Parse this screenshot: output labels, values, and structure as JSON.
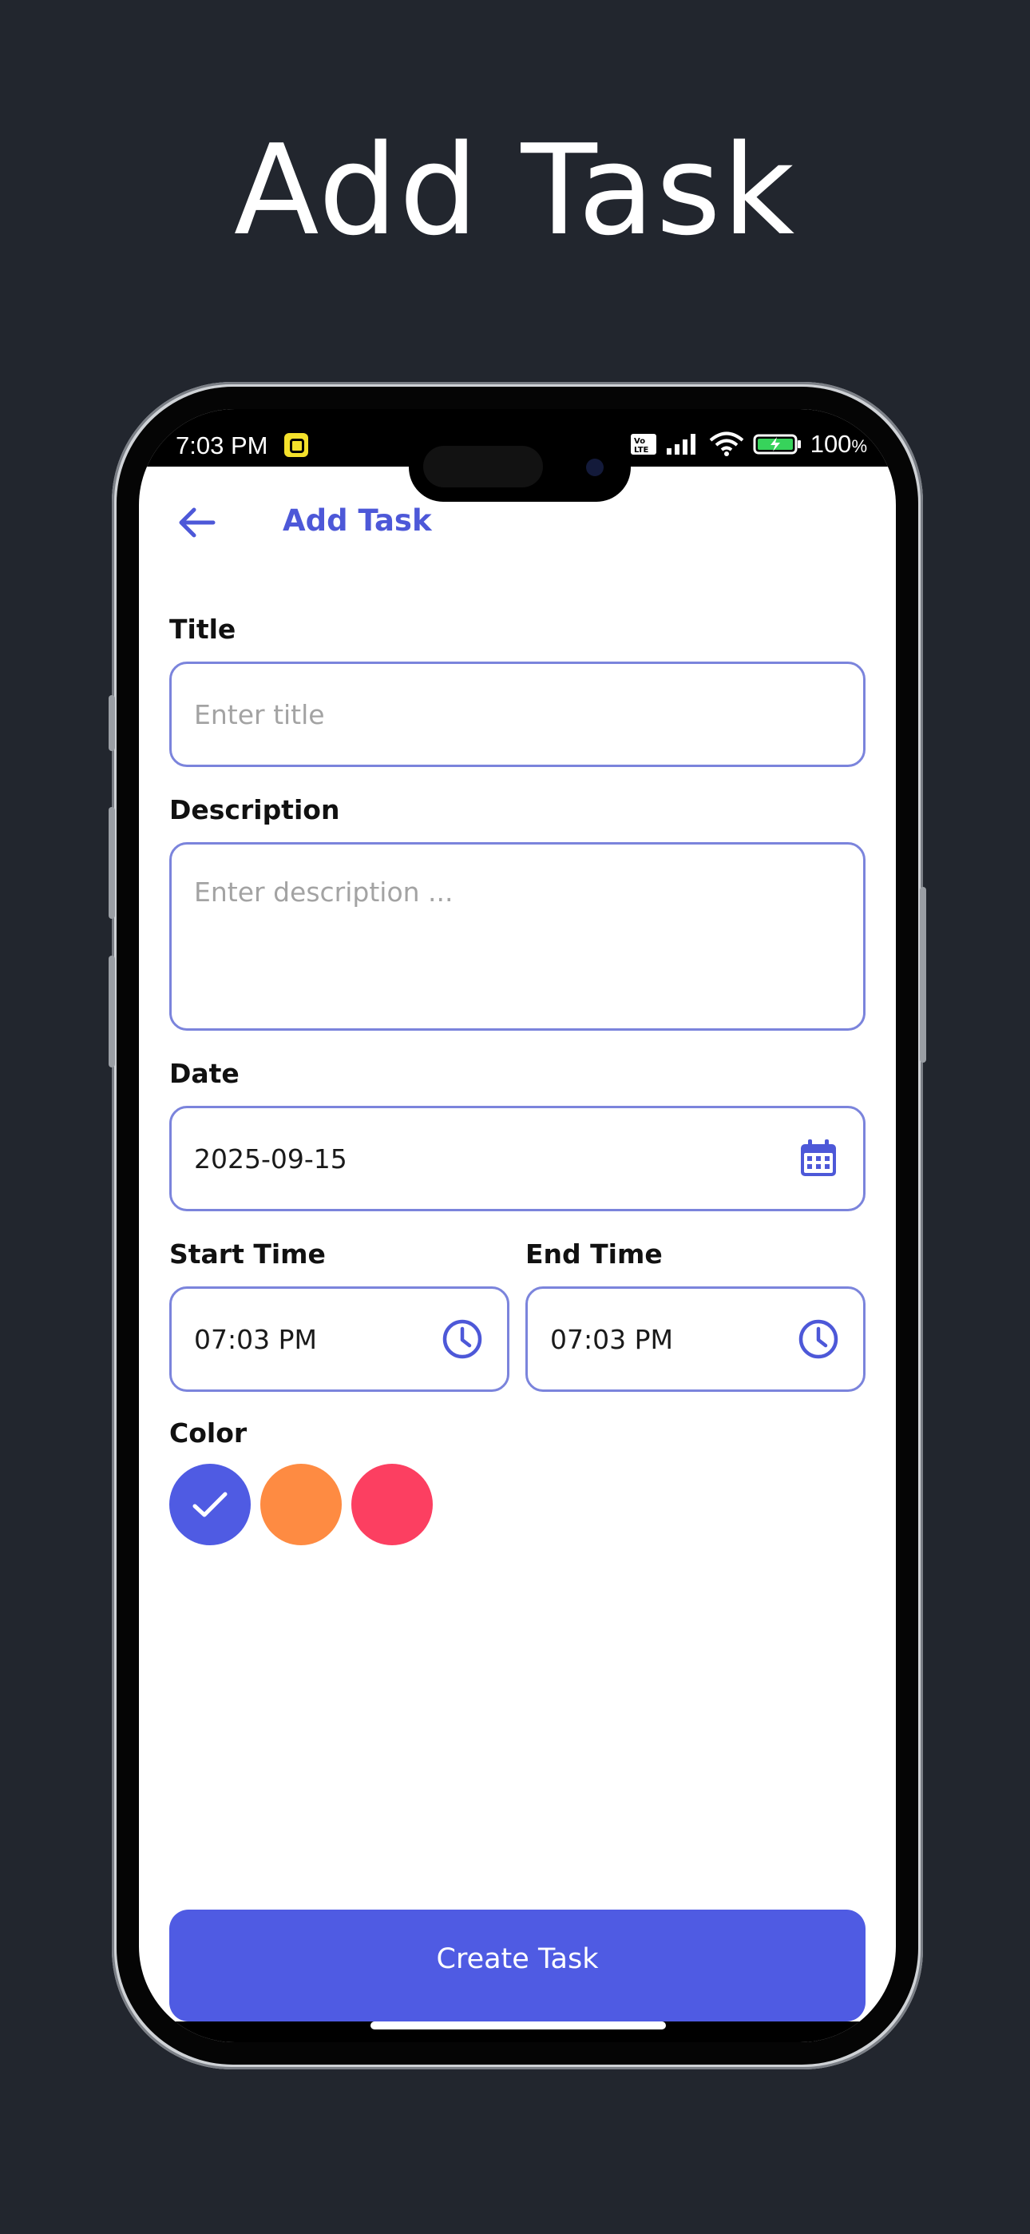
{
  "hero": {
    "title": "Add Task"
  },
  "status_bar": {
    "time": "7:03 PM",
    "battery_percent": "100",
    "battery_suffix": "%",
    "icons": [
      "instagram-notification-icon",
      "volte-icon",
      "signal-icon",
      "wifi-icon",
      "battery-charging-icon"
    ]
  },
  "app_bar": {
    "back_icon": "arrow-left-icon",
    "title": "Add Task"
  },
  "form": {
    "title": {
      "label": "Title",
      "placeholder": "Enter title",
      "value": ""
    },
    "description": {
      "label": "Description",
      "placeholder": "Enter description ...",
      "value": ""
    },
    "date": {
      "label": "Date",
      "value": "2025-09-15",
      "icon": "calendar-icon"
    },
    "start_time": {
      "label": "Start Time",
      "value": "07:03 PM",
      "icon": "clock-icon"
    },
    "end_time": {
      "label": "End Time",
      "value": "07:03 PM",
      "icon": "clock-icon"
    },
    "color": {
      "label": "Color",
      "options": [
        {
          "name": "blue",
          "hex": "#4f5be3",
          "selected": true
        },
        {
          "name": "orange",
          "hex": "#fe8b42",
          "selected": false
        },
        {
          "name": "pink",
          "hex": "#fc3f61",
          "selected": false
        }
      ]
    }
  },
  "actions": {
    "create_label": "Create Task"
  },
  "colors": {
    "background": "#22262e",
    "accent": "#4d58d8",
    "field_border": "#7b84dc",
    "button": "#4f5be3"
  }
}
